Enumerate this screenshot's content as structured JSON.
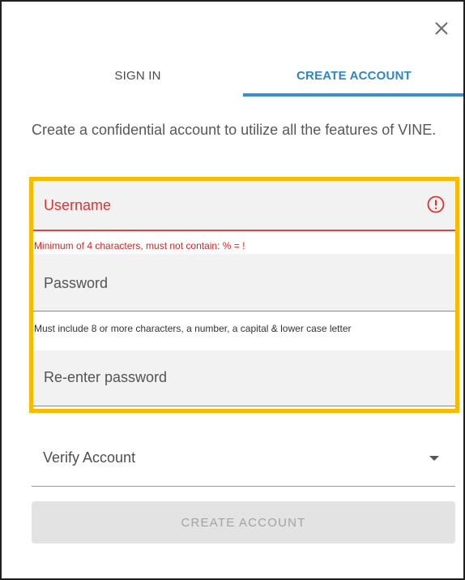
{
  "dialog": {
    "close_icon": "close-icon"
  },
  "tabs": [
    {
      "label": "SIGN IN",
      "active": false
    },
    {
      "label": "CREATE ACCOUNT",
      "active": true
    }
  ],
  "intro_text": "Create a confidential account to utilize all the features of VINE.",
  "form": {
    "username": {
      "label": "Username",
      "value": "",
      "error": "Minimum of 4 characters, must not contain: % = !",
      "status_icon": "error-icon"
    },
    "password": {
      "label": "Password",
      "value": "",
      "hint": "Must include 8 or more characters, a number, a capital & lower case letter"
    },
    "reenter_password": {
      "label": "Re-enter password",
      "value": ""
    },
    "verify": {
      "selected": "Verify Account",
      "icon": "caret-down-icon"
    },
    "submit_label": "CREATE ACCOUNT",
    "submit_enabled": false
  },
  "colors": {
    "accent": "#2d87c6",
    "error": "#dd3333",
    "highlight": "#f6bd00",
    "disabled_button": "#e3e3e3"
  }
}
